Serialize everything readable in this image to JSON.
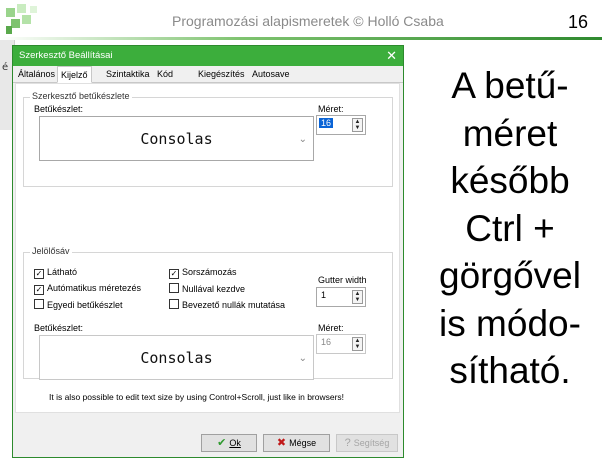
{
  "slide": {
    "header_title": "Programozási alapismeretek © Holló Csaba",
    "page_number": "16",
    "text_lines": [
      "A betű-",
      "méret",
      "később",
      "Ctrl +",
      "görgővel",
      "is módo-",
      "sítható."
    ]
  },
  "background_app": {
    "menu_fragment": "é"
  },
  "dialog": {
    "title": "Szerkesztő Beállításai",
    "close_glyph": "✕",
    "tabs": [
      {
        "label": "Általános"
      },
      {
        "label": "Kijelző"
      },
      {
        "label": "Szintaktika"
      },
      {
        "label": "Kód"
      },
      {
        "label": "Kiegészítés"
      },
      {
        "label": "Autosave"
      }
    ],
    "active_tab": "Kijelző",
    "editor_font": {
      "group_label": "Szerkesztő betűkészlete",
      "font_label": "Betűkészlet:",
      "font_value": "Consolas",
      "size_label": "Méret:",
      "size_value": "16"
    },
    "gutter": {
      "group_label": "Jelölősáv",
      "checkboxes": {
        "visible": {
          "label": "Látható",
          "checked": true
        },
        "auto_size": {
          "label": "Autómatikus méretezés",
          "checked": true
        },
        "custom_font": {
          "label": "Egyedi betűkészlet",
          "checked": false
        },
        "line_numbers": {
          "label": "Sorszámozás",
          "checked": true
        },
        "start_zero": {
          "label": "Nullával kezdve",
          "checked": false
        },
        "leading_zeros": {
          "label": "Bevezető nullák mutatása",
          "checked": false
        }
      },
      "gutter_width_label": "Gutter width",
      "gutter_width_value": "1",
      "font_label": "Betűkészlet:",
      "font_value": "Consolas",
      "size_label": "Méret:",
      "size_value": "16"
    },
    "info_text": "It is also possible to edit text size by using Control+Scroll, just like in browsers!",
    "buttons": {
      "ok": {
        "label": "Ok",
        "icon": "✔"
      },
      "cancel": {
        "label": "Mégse",
        "icon": "✖"
      },
      "help": {
        "label": "Segítség",
        "icon": "?"
      }
    },
    "check_glyph": "✓"
  },
  "colors": {
    "titlebar": "#3cae3c",
    "ok_icon": "#2e9a2e",
    "cancel_icon": "#c01818",
    "selection": "#0a64d6"
  }
}
